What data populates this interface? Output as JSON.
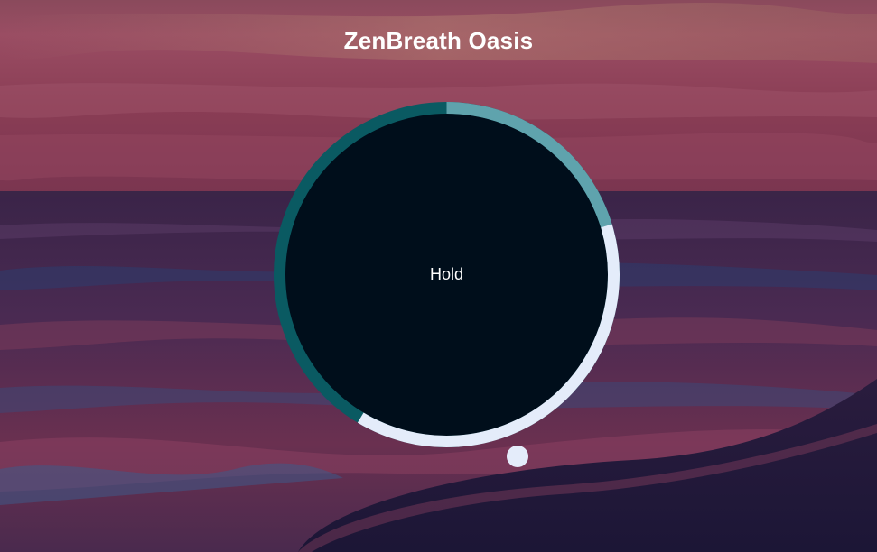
{
  "app": {
    "title": "ZenBreath Oasis"
  },
  "breathing": {
    "phase_label": "Hold"
  },
  "colors": {
    "ring_base": "#0a5a62",
    "ring_segment_inhale": "#5fa3ad",
    "ring_segment_hold": "#e4ecfa",
    "circle_fill": "#000e1b",
    "pointer": "#e4ecfa"
  },
  "icons": {
    "pointer": "progress-indicator-dot-icon"
  }
}
